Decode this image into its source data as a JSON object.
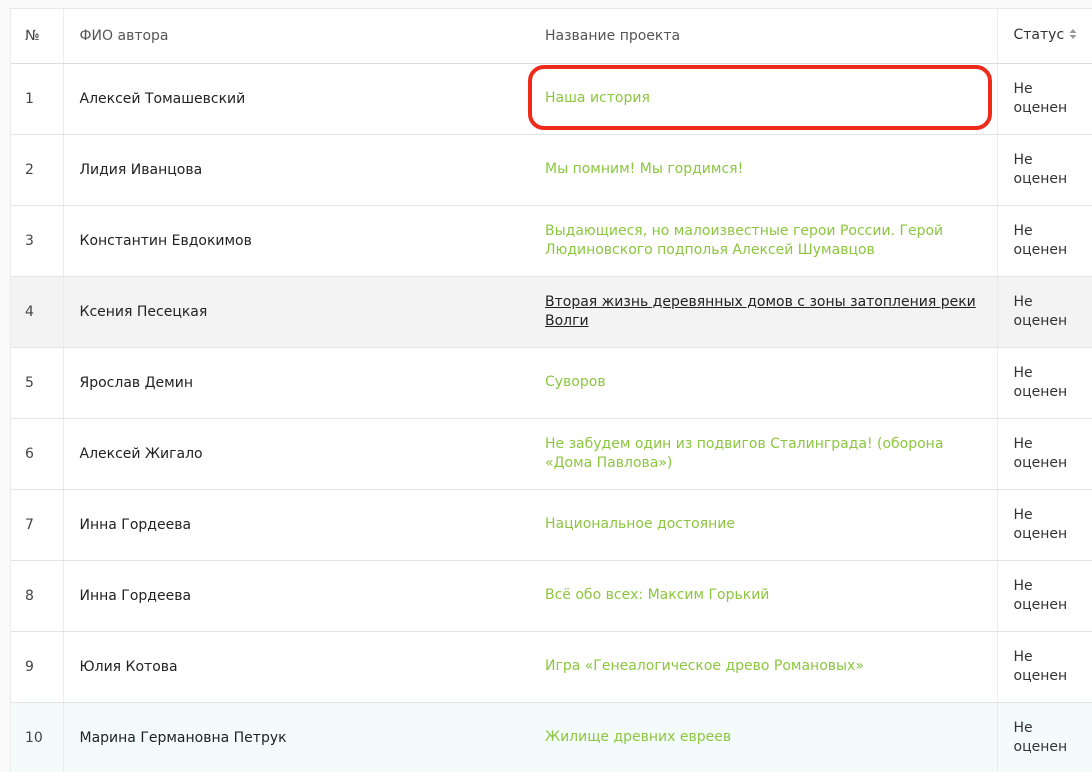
{
  "table": {
    "headers": {
      "num": "№",
      "author": "ФИО автора",
      "title": "Название проекта",
      "status": "Статус"
    },
    "rows": [
      {
        "num": "1",
        "author": "Алексей Томашевский",
        "title": "Наша история",
        "status": "Не оценен"
      },
      {
        "num": "2",
        "author": "Лидия Иванцова",
        "title": "Мы помним! Мы гордимся!",
        "status": "Не оценен"
      },
      {
        "num": "3",
        "author": "Константин Евдокимов",
        "title": "Выдающиеся, но малоизвестные герои России. Герой Людиновского подполья Алексей Шумавцов",
        "status": "Не оценен"
      },
      {
        "num": "4",
        "author": "Ксения Песецкая",
        "title": "Вторая жизнь деревянных домов с зоны затопления реки Волги",
        "status": "Не оценен"
      },
      {
        "num": "5",
        "author": "Ярослав Демин",
        "title": "Суворов",
        "status": "Не оценен"
      },
      {
        "num": "6",
        "author": "Алексей Жигало",
        "title": "Не забудем один из подвигов Сталинграда! (оборона «Дома Павлова»)",
        "status": "Не оценен"
      },
      {
        "num": "7",
        "author": "Инна Гордеева",
        "title": "Национальное достояние",
        "status": "Не оценен"
      },
      {
        "num": "8",
        "author": "Инна Гордеева",
        "title": "Всё обо всех: Максим Горький",
        "status": "Не оценен"
      },
      {
        "num": "9",
        "author": "Юлия Котова",
        "title": "Игра «Генеалогическое древо Романовых»",
        "status": "Не оценен"
      },
      {
        "num": "10",
        "author": "Марина Германовна Петрук",
        "title": "Жилище древних евреев",
        "status": "Не оценен"
      }
    ]
  },
  "icons": {
    "sort": "sort-updown-icon"
  },
  "colors": {
    "link": "#8cc63f",
    "highlight": "#ee2a1b",
    "hover_row": "#f3f3f3"
  }
}
